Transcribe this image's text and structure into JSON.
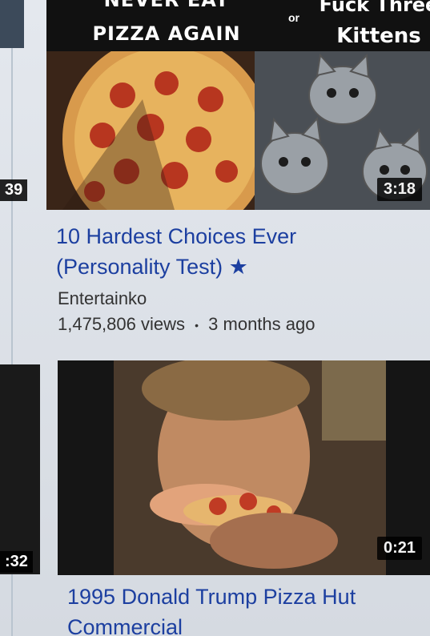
{
  "videos": [
    {
      "thumbnail_text": {
        "left_line1": "NEVER EAT",
        "left_line2": "PIZZA AGAIN",
        "middle": "or",
        "right_line1": "Fuck Three",
        "right_line2": "Kittens"
      },
      "duration": "3:18",
      "title_line1": "10 Hardest Choices Ever",
      "title_line2": "(Personality Test)",
      "title_icon": "★",
      "channel": "Entertainko",
      "views": "1,475,806 views",
      "separator": "•",
      "age": "3 months ago"
    },
    {
      "duration": "0:21",
      "title_line1": "1995 Donald Trump Pizza Hut",
      "title_line2": "Commercial"
    }
  ],
  "left_partial_durations": [
    "39",
    ":32"
  ],
  "colors": {
    "title": "#1c3fa0",
    "meta": "#333333",
    "duration_bg": "#000000"
  }
}
